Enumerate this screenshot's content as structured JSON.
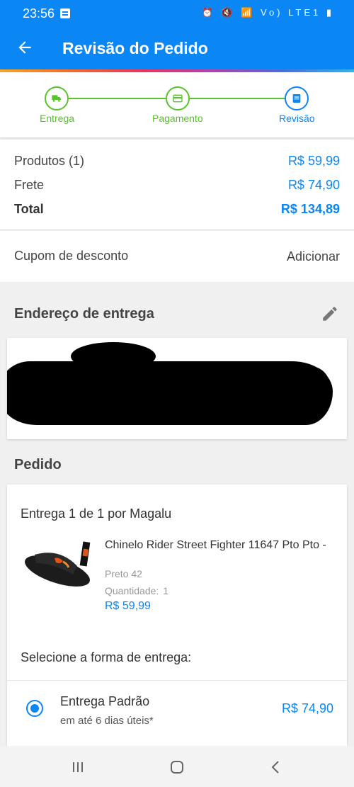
{
  "status_bar": {
    "time": "23:56",
    "right_icons": "⏰ 🔇 📶 Vo) LTE1 ▮"
  },
  "app_bar": {
    "title": "Revisão do Pedido"
  },
  "stepper": {
    "steps": [
      {
        "label": "Entrega",
        "icon": "truck-icon",
        "state": "done"
      },
      {
        "label": "Pagamento",
        "icon": "card-icon",
        "state": "done"
      },
      {
        "label": "Revisão",
        "icon": "list-icon",
        "state": "current"
      }
    ],
    "colors": {
      "done": "#58c32a",
      "current": "#0a86f5"
    }
  },
  "summary": {
    "products_label": "Produtos (1)",
    "products_value": "R$ 59,99",
    "shipping_label": "Frete",
    "shipping_value": "R$ 74,90",
    "total_label": "Total",
    "total_value": "R$ 134,89"
  },
  "coupon": {
    "label": "Cupom de desconto",
    "action": "Adicionar"
  },
  "address": {
    "title": "Endereço de entrega",
    "edit_icon": "pencil-icon",
    "content_redacted": true
  },
  "order": {
    "title": "Pedido",
    "seller_line": "Entrega 1 de 1 por Magalu",
    "product": {
      "name": "Chinelo Rider Street Fighter 11647 Pto Pto -",
      "variant": "Preto 42",
      "qty_label": "Quantidade:",
      "qty": "1",
      "price": "R$ 59,99"
    },
    "shipping_prompt": "Selecione a forma de entrega:",
    "shipping_option": {
      "name": "Entrega Padrão",
      "eta": "em até 6 dias úteis*",
      "price": "R$ 74,90",
      "selected": true
    }
  },
  "nav_bar": {
    "icons": [
      "recent-apps-icon",
      "home-icon",
      "back-icon"
    ]
  },
  "colors": {
    "primary": "#0a86f5",
    "success": "#58c32a"
  }
}
